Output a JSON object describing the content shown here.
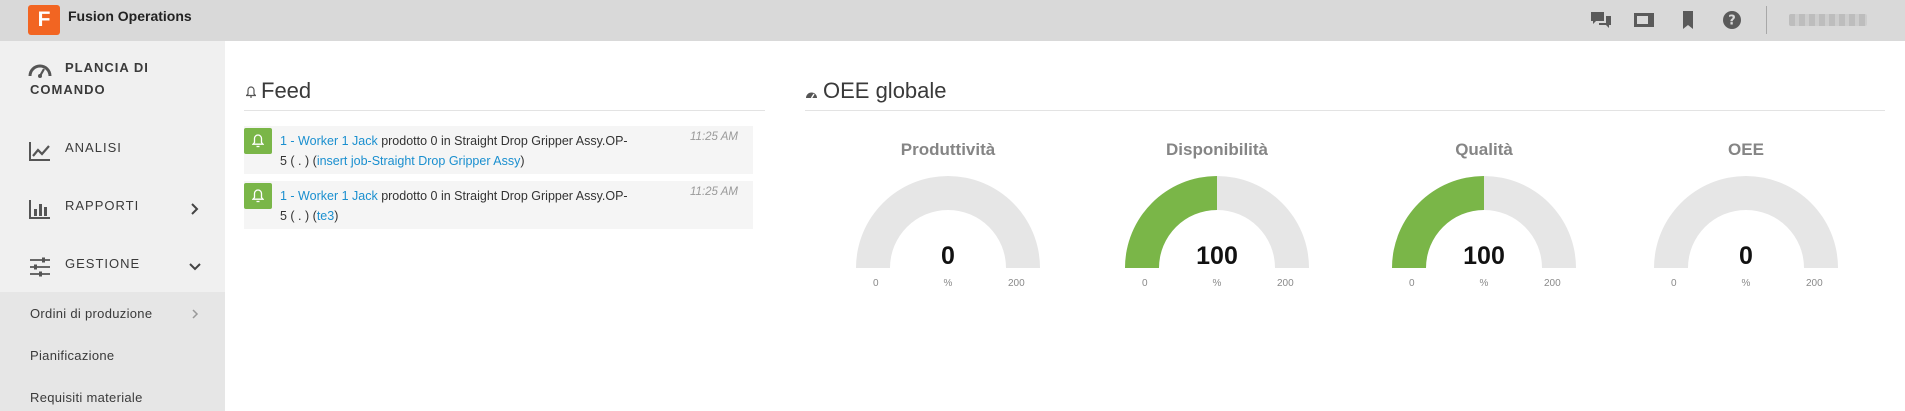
{
  "app": {
    "logo_letter": "F",
    "title": "Fusion Operations",
    "brand_color": "#f26522"
  },
  "topbar_icons": [
    "chat-icon",
    "screen-icon",
    "bookmark-icon",
    "help-icon"
  ],
  "sidebar": {
    "items": [
      {
        "label_line1": "PLANCIA DI",
        "label_line2": "COMANDO",
        "icon": "dashboard-gauge-icon"
      },
      {
        "label": "ANALISI",
        "icon": "line-chart-icon"
      },
      {
        "label": "RAPPORTI",
        "icon": "bar-chart-icon",
        "chevron": "chevron-right-icon"
      },
      {
        "label": "GESTIONE",
        "icon": "sliders-icon",
        "chevron": "chevron-down-icon"
      }
    ],
    "sub_items": [
      {
        "label": "Ordini di produzione",
        "chevron": "chevron-right-icon"
      },
      {
        "label": "Pianificazione"
      },
      {
        "label": "Requisiti materiale"
      }
    ]
  },
  "feed": {
    "title": "Feed",
    "items": [
      {
        "link1": "1 - Worker 1 Jack",
        "text1": " prodotto 0 in Straight Drop Gripper Assy.OP-",
        "text2": "5 ( . ) (",
        "link2": "insert job-Straight Drop Gripper Assy",
        "text3": ")",
        "time": "11:25 AM"
      },
      {
        "link1": "1 - Worker 1 Jack",
        "text1": " prodotto 0 in Straight Drop Gripper Assy.OP-",
        "text2": "5 ( . ) (",
        "link2": "te3",
        "text3": ")",
        "time": "11:25 AM"
      }
    ]
  },
  "oee": {
    "title": "OEE globale",
    "accent_color": "#7ab648",
    "track_color": "#e6e6e6",
    "gauges": [
      {
        "title": "Produttività",
        "value": "0",
        "fraction": 0,
        "min": "0",
        "max": "200",
        "unit": "%"
      },
      {
        "title": "Disponibilità",
        "value": "100",
        "fraction": 0.5,
        "min": "0",
        "max": "200",
        "unit": "%"
      },
      {
        "title": "Qualità",
        "value": "100",
        "fraction": 0.5,
        "min": "0",
        "max": "200",
        "unit": "%"
      },
      {
        "title": "OEE",
        "value": "0",
        "fraction": 0,
        "min": "0",
        "max": "200",
        "unit": "%"
      }
    ]
  }
}
